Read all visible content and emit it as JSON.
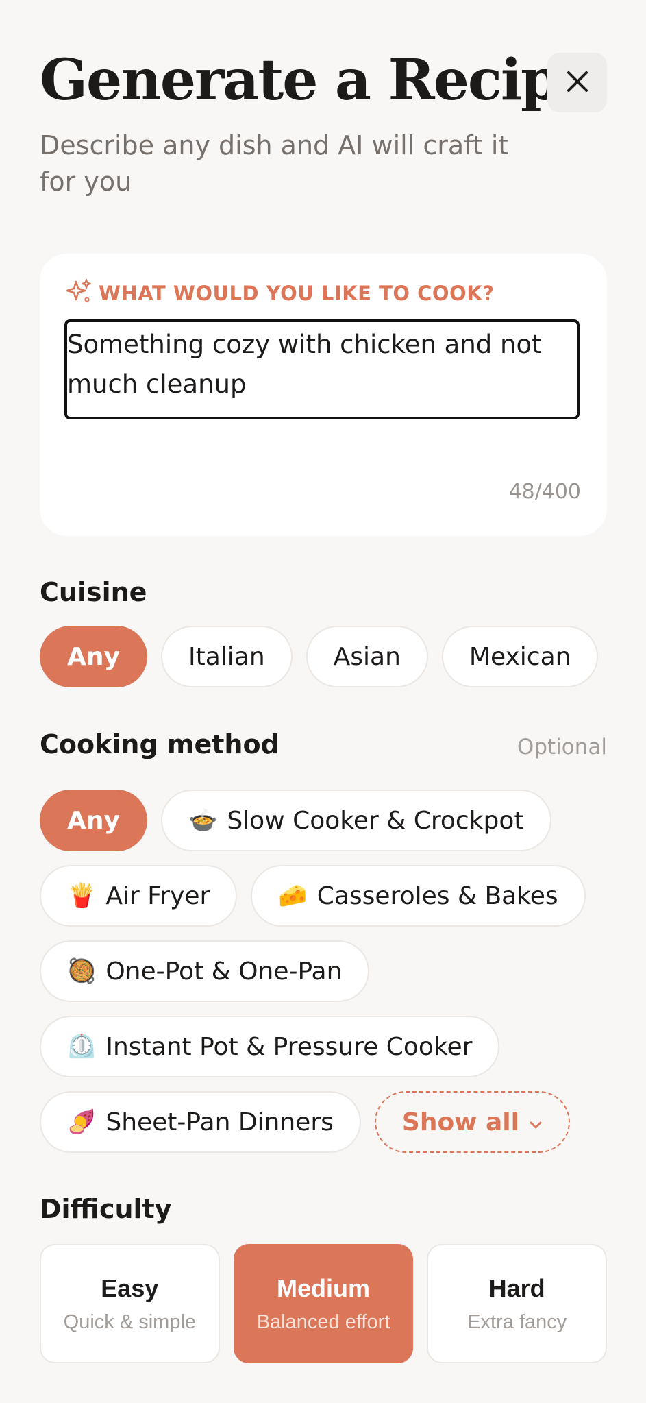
{
  "header": {
    "title": "Generate a Recipe",
    "subtitle": "Describe any dish and AI will craft it for you",
    "close_icon": "close-icon"
  },
  "prompt": {
    "label": "WHAT WOULD YOU LIKE TO COOK?",
    "label_icon": "sparkles-icon",
    "value": "Something cozy with chicken and not much cleanup",
    "char_count": "48/400"
  },
  "cuisine": {
    "title": "Cuisine",
    "options": [
      "Any",
      "Italian",
      "Asian",
      "Mexican",
      ""
    ],
    "selected": "Any"
  },
  "cooking_method": {
    "title": "Cooking method",
    "optional_label": "Optional",
    "any_label": "Any",
    "options": [
      {
        "emoji": "🍲",
        "label": "Slow Cooker & Crockpot"
      },
      {
        "emoji": "🍟",
        "label": "Air Fryer"
      },
      {
        "emoji": "🧀",
        "label": "Casseroles & Bakes"
      },
      {
        "emoji": "🥘",
        "label": "One-Pot & One-Pan"
      },
      {
        "emoji": "⏲️",
        "label": "Instant Pot & Pressure Cooker"
      },
      {
        "emoji": "🍠",
        "label": "Sheet-Pan Dinners"
      }
    ],
    "show_all_label": "Show all",
    "selected": "Any"
  },
  "difficulty": {
    "title": "Difficulty",
    "options": [
      {
        "name": "Easy",
        "desc": "Quick & simple"
      },
      {
        "name": "Medium",
        "desc": "Balanced effort"
      },
      {
        "name": "Hard",
        "desc": "Extra fancy"
      }
    ],
    "selected": "Medium"
  },
  "colors": {
    "accent": "#dc7658",
    "background": "#f8f7f6",
    "card": "#ffffff",
    "text": "#1d1b1a",
    "muted": "#77716d"
  }
}
